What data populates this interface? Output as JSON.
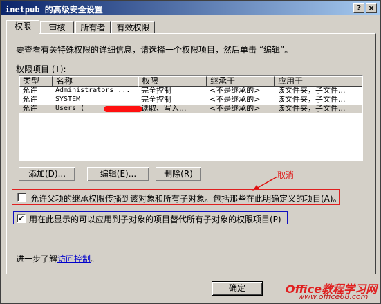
{
  "window": {
    "title": "inetpub 的高级安全设置",
    "help": "?",
    "close": "×"
  },
  "tabs": [
    {
      "label": "权限"
    },
    {
      "label": "审核"
    },
    {
      "label": "所有者"
    },
    {
      "label": "有效权限"
    }
  ],
  "description": "要查看有关特殊权限的详细信息，请选择一个权限项目，然后单击 “编辑”。",
  "list": {
    "label": "权限项目 (T):",
    "columns": [
      "类型",
      "名称",
      "权限",
      "继承于",
      "应用于"
    ],
    "rows": [
      {
        "type": "允许",
        "name": "Administrators ...",
        "perm": "完全控制",
        "inherit": "<不是继承的>",
        "apply": "该文件夹，子文件..."
      },
      {
        "type": "允许",
        "name": "SYSTEM",
        "perm": "完全控制",
        "inherit": "<不是继承的>",
        "apply": "该文件夹，子文件..."
      },
      {
        "type": "允许",
        "name": "Users (",
        "perm": "读取、写入...",
        "inherit": "<不是继承的>",
        "apply": "该文件夹，子文件..."
      }
    ]
  },
  "buttons": {
    "add": "添加(D)...",
    "edit": "编辑(E)...",
    "delete": "删除(R)",
    "ok": "确定"
  },
  "annotation": {
    "cancel": "取消",
    "red": "#e01010"
  },
  "options": {
    "inherit_label": "允许父项的继承权限传播到该对象和所有子对象。包括那些在此明确定义的项目(A)。",
    "inherit_checked": false,
    "replace_label": "用在此显示的可以应用到子对象的项目替代所有子对象的权限项目(P)",
    "replace_checked": true
  },
  "footer": {
    "more_prefix": "进一步了解",
    "more_link": "访问控制",
    "more_suffix": "。"
  },
  "watermark": {
    "line1": "Office教程学习网",
    "line2": "www.office68.com"
  }
}
